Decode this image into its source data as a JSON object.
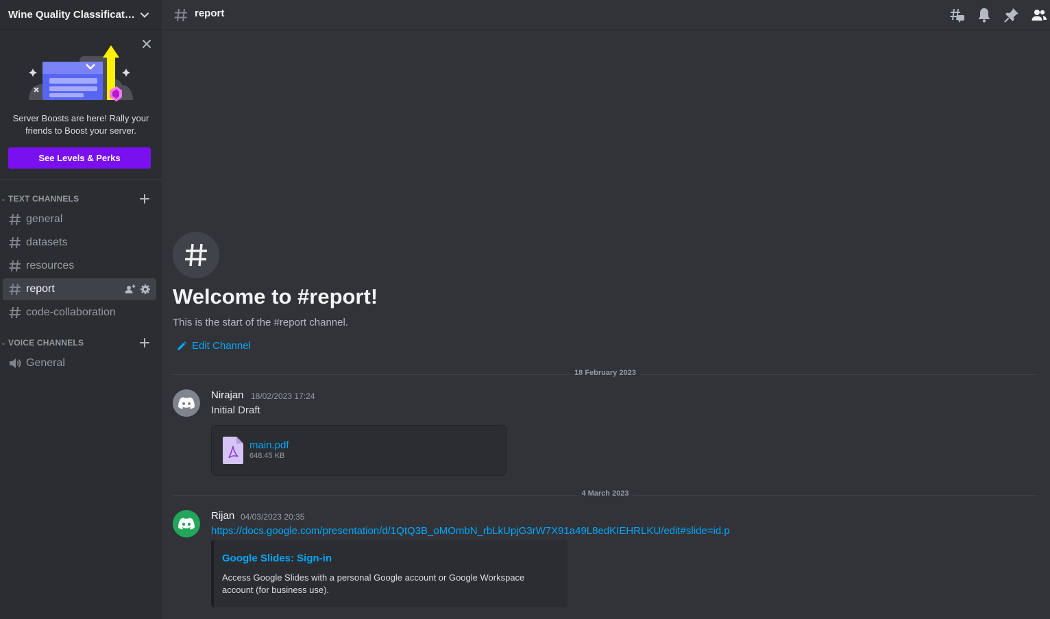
{
  "server": {
    "name": "Wine Quality Classificati..."
  },
  "boost": {
    "text": "Server Boosts are here! Rally your friends to Boost your server.",
    "button": "See Levels & Perks"
  },
  "sidebar": {
    "text_category": "TEXT CHANNELS",
    "voice_category": "VOICE CHANNELS",
    "text_channels": [
      {
        "label": "general"
      },
      {
        "label": "datasets"
      },
      {
        "label": "resources"
      },
      {
        "label": "report",
        "active": true
      },
      {
        "label": "code-collaboration"
      }
    ],
    "voice_channels": [
      {
        "label": "General"
      }
    ]
  },
  "topbar": {
    "title": "report"
  },
  "welcome": {
    "title": "Welcome to #report!",
    "subtitle": "This is the start of the #report channel.",
    "edit": "Edit Channel"
  },
  "messages": [
    {
      "date_divider": "18 February 2023",
      "author": "Nirajan",
      "timestamp": "18/02/2023 17:24",
      "text": "Initial Draft",
      "avatar_color": "#80848e",
      "attachment": {
        "name": "main.pdf",
        "size": "648.45 KB"
      }
    },
    {
      "date_divider": "4 March 2023",
      "author": "Rijan",
      "timestamp": "04/03/2023 20:35",
      "link": "https://docs.google.com/presentation/d/1QtQ3B_oMOmbN_rbLkUpjG3rW7X91a49L8edKIEHRLKU/edit#slide=id.p",
      "avatar_color": "#23a55a",
      "embed": {
        "title": "Google Slides: Sign-in",
        "description": "Access Google Slides with a personal Google account or Google Workspace account (for business use)."
      }
    }
  ],
  "colors": {
    "accent": "#00a8fc",
    "boost_button": "#7a10f0",
    "background": "#313338",
    "sidebar": "#2b2d31"
  }
}
